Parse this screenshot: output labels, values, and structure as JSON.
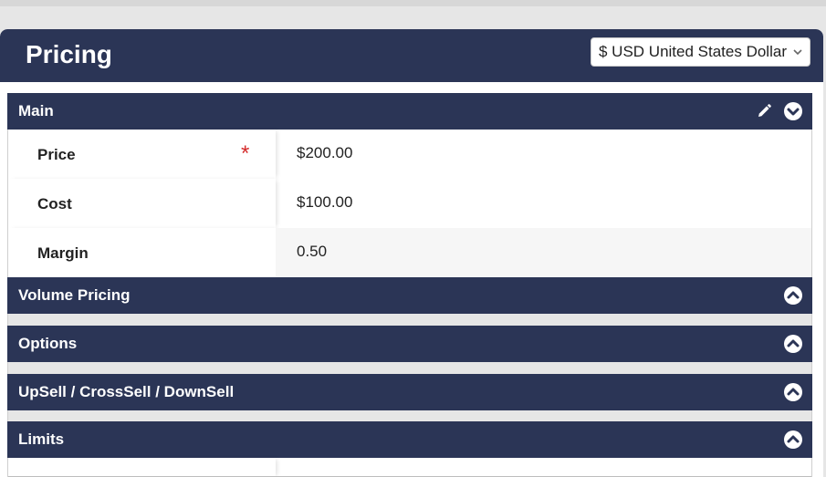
{
  "panel": {
    "title": "Pricing",
    "currency": "$ USD United States Dollar"
  },
  "sections": {
    "main": {
      "label": "Main",
      "rows": [
        {
          "label": "Price",
          "value": "$200.00",
          "required": "*"
        },
        {
          "label": "Cost",
          "value": "$100.00"
        },
        {
          "label": "Margin",
          "value": "0.50"
        }
      ]
    },
    "volume_pricing": {
      "label": "Volume Pricing"
    },
    "options": {
      "label": "Options"
    },
    "upsell": {
      "label": "UpSell / CrossSell / DownSell"
    },
    "limits": {
      "label": "Limits"
    }
  },
  "icons": {
    "edit": "pencil-icon",
    "collapse": "chevron-down-circle-icon",
    "expand": "chevron-up-circle-icon",
    "select": "chevron-down-icon"
  },
  "colors": {
    "header_bg": "#2b3556",
    "required": "#d42a2a",
    "page_bg": "#e6e6e6"
  }
}
